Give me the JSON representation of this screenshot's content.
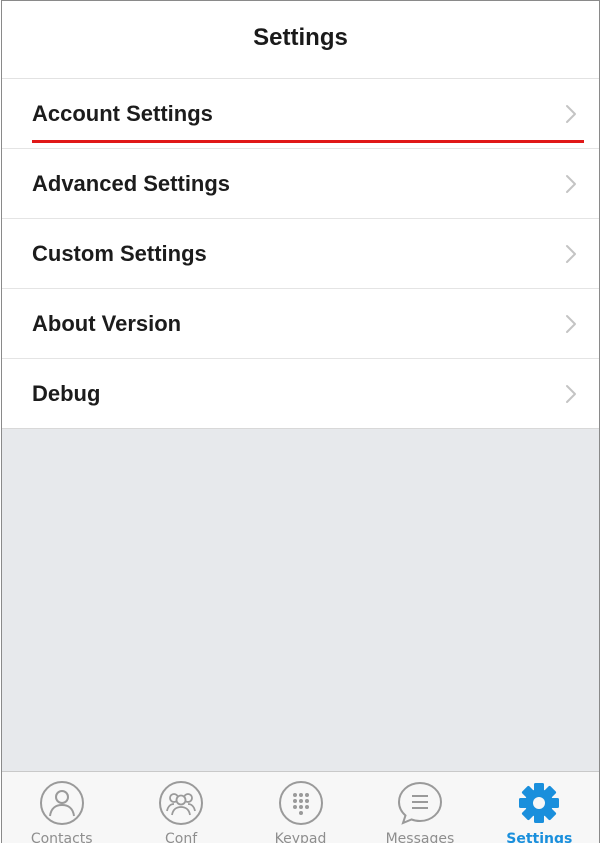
{
  "navbar": {
    "title": "Settings"
  },
  "settings": {
    "items": [
      {
        "label": "Account Settings"
      },
      {
        "label": "Advanced Settings"
      },
      {
        "label": "Custom Settings"
      },
      {
        "label": "About Version"
      },
      {
        "label": "Debug"
      }
    ]
  },
  "tabbar": {
    "tabs": [
      {
        "label": "Contacts",
        "icon": "contacts-icon"
      },
      {
        "label": "Conf",
        "icon": "conference-icon"
      },
      {
        "label": "Keypad",
        "icon": "keypad-icon"
      },
      {
        "label": "Messages",
        "icon": "messages-icon"
      },
      {
        "label": "Settings",
        "icon": "gear-icon",
        "active": true
      }
    ]
  },
  "colors": {
    "accent": "#1a8fdc",
    "highlight": "#e01818",
    "inactive_icon": "#9a9a9a",
    "background": "#e7e9ec"
  }
}
